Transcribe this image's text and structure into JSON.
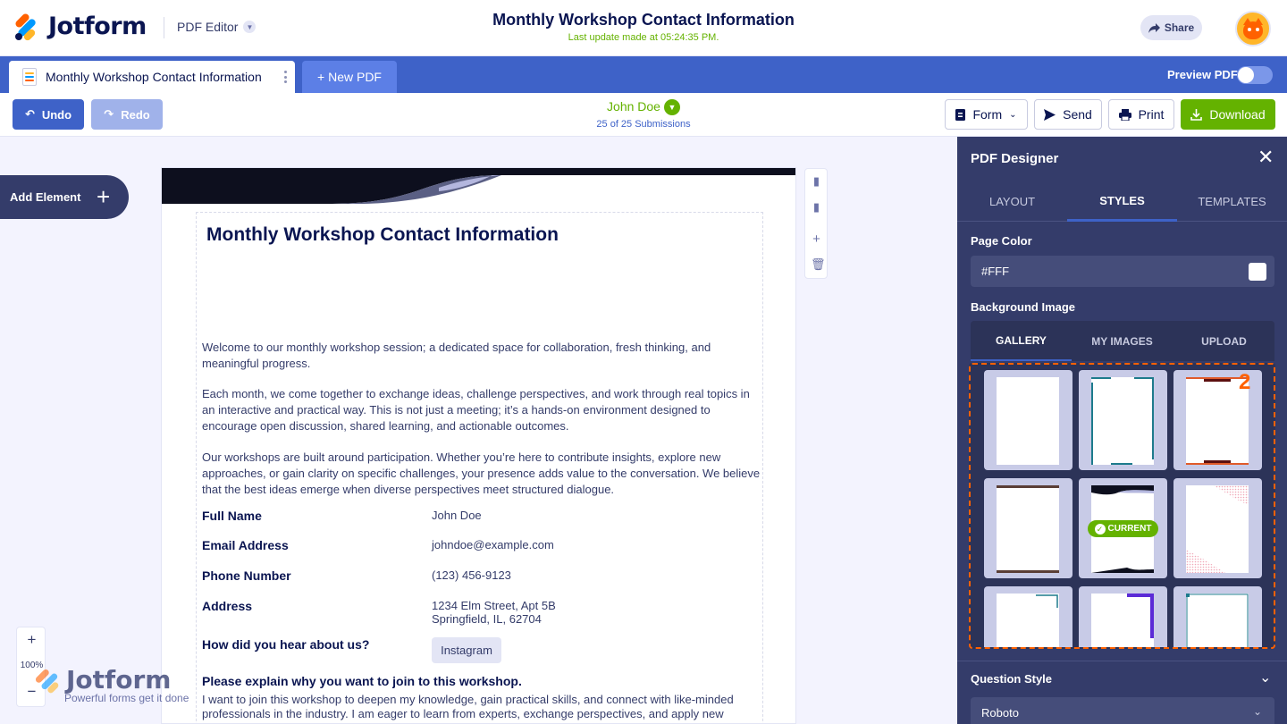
{
  "header": {
    "brand": "Jotform",
    "app_name": "PDF Editor",
    "doc_title": "Monthly Workshop Contact Information",
    "last_update": "Last update made at 05:24:35 PM.",
    "share_label": "Share"
  },
  "tabs": {
    "active_doc": "Monthly Workshop Contact Information",
    "new_pdf": "+ New PDF",
    "preview_label": "Preview PDF",
    "preview_on": false
  },
  "toolbar": {
    "undo": "Undo",
    "redo": "Redo",
    "submitter": "John Doe",
    "submission_count": "25 of 25 Submissions",
    "form": "Form",
    "send": "Send",
    "print": "Print",
    "download": "Download"
  },
  "canvas": {
    "add_element": "Add Element",
    "zoom_plus": "+",
    "zoom_level": "100%",
    "zoom_minus": "−",
    "watermark": "Jotform",
    "watermark_tagline": "Powerful forms get it done"
  },
  "document": {
    "title": "Monthly Workshop Contact Information",
    "intro": "Welcome to our monthly workshop session; a dedicated space for collaboration, fresh thinking, and meaningful progress.",
    "para2": "Each month, we come together to exchange ideas, challenge perspectives, and work through real topics in an interactive and practical way. This is not just a meeting; it’s a hands-on environment designed to encourage open discussion, shared learning, and actionable outcomes.",
    "para3": "Our workshops are built around participation. Whether you’re here to contribute insights, explore new approaches, or gain clarity on specific challenges, your presence adds value to the conversation. We believe that the best ideas emerge when diverse perspectives meet structured dialogue.",
    "fields": {
      "full_name_label": "Full Name",
      "full_name": "John Doe",
      "email_label": "Email Address",
      "email": "johndoe@example.com",
      "phone_label": "Phone Number",
      "phone": "(123) 456-9123",
      "address_label": "Address",
      "address_line1": "1234 Elm Street, Apt 5B",
      "address_line2": "Springfield, IL, 62704",
      "heard_label": "How did you hear about us?",
      "heard": "Instagram",
      "why_label": "Please explain why you want to join to this workshop.",
      "why": "I want to join this workshop to deepen my knowledge, gain practical skills, and connect with like-minded professionals in the industry. I am eager to learn from experts, exchange perspectives, and apply new"
    }
  },
  "panel": {
    "title": "PDF Designer",
    "tabs": [
      "LAYOUT",
      "STYLES",
      "TEMPLATES"
    ],
    "active_tab": "STYLES",
    "page_color_label": "Page Color",
    "page_color": "#FFF",
    "bg_image_label": "Background Image",
    "bg_tabs": [
      "GALLERY",
      "MY IMAGES",
      "UPLOAD"
    ],
    "annotation_number": "2",
    "current_label": "CURRENT",
    "question_style_label": "Question Style",
    "font": "Roboto"
  },
  "colors": {
    "navy": "#0a1551",
    "blue": "#3e62c8",
    "green": "#64b200",
    "orange": "#ff6100",
    "panel": "#343c6a"
  }
}
